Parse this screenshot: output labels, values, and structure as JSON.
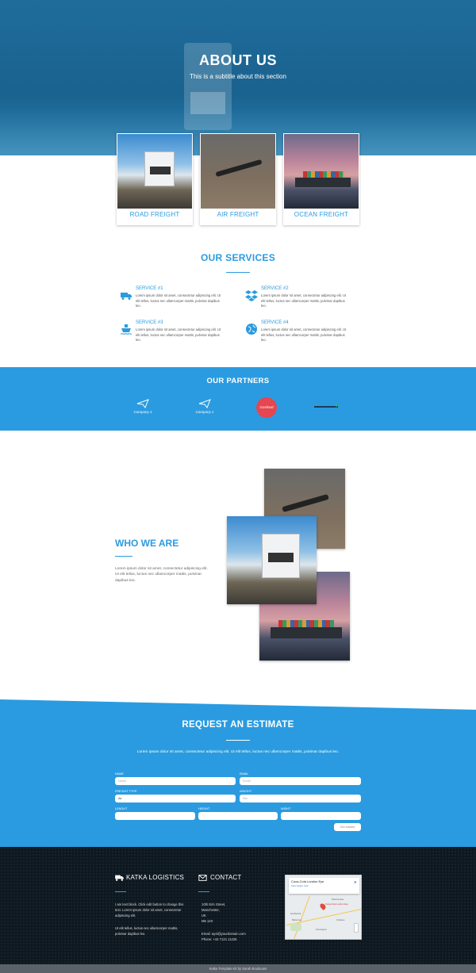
{
  "hero": {
    "title": "ABOUT US",
    "subtitle": "This is a subtitle about this section"
  },
  "freight": [
    {
      "label": "ROAD FREIGHT"
    },
    {
      "label": "AIR FREIGHT"
    },
    {
      "label": "OCEAN FREIGHT"
    }
  ],
  "services": {
    "title": "OUR SERVICES",
    "items": [
      {
        "title": "SERVICE #1",
        "icon": "truck-icon",
        "text": "Lorem ipsum dolor sit amet, consectetur adipiscing elit. Ut elit tellus, luctus nec ullamcorper mattis, pulvinar dapibus leo."
      },
      {
        "title": "SERVICE #2",
        "icon": "dropbox-icon",
        "text": "Lorem ipsum dolor sit amet, consectetur adipiscing elit. Ut elit tellus, luctus nec ullamcorper mattis, pulvinar dapibus leo."
      },
      {
        "title": "SERVICE #3",
        "icon": "ship-icon",
        "text": "Lorem ipsum dolor sit amet, consectetur adipiscing elit. Ut elit tellus, luctus nec ullamcorper mattis, pulvinar dapibus leo."
      },
      {
        "title": "SERVICE #4",
        "icon": "globe-icon",
        "text": "Lorem ipsum dolor sit amet, consectetur adipiscing elit. Ut elit tellus, luctus nec ullamcorper mattis, pulvinar dapibus leo."
      }
    ]
  },
  "partners": {
    "title": "OUR PARTNERS",
    "logos": [
      {
        "name": "Company 1"
      },
      {
        "name": "Company 1"
      },
      {
        "name": "Gasfood"
      },
      {
        "name": ""
      }
    ]
  },
  "who": {
    "title": "WHO WE ARE",
    "text": "Lorem ipsum dolor sit amet, consectetur adipiscing elit. Ut elit tellus, luctus nec ullamcorper mattis, pulvinar dapibus leo."
  },
  "estimate": {
    "title": "REQUEST AN ESTIMATE",
    "desc": "Lorem ipsum dolor sit amet, consectetur adipiscing elit. Ut elit tellus, luctus nec ullamcorper mattis, pulvinar dapibus leo.",
    "fields": {
      "name": {
        "label": "NAME",
        "placeholder": "Name"
      },
      "email": {
        "label": "EMAIL",
        "placeholder": "Email"
      },
      "freight": {
        "label": "FREIGHT TYPE",
        "value": "Air"
      },
      "weight": {
        "label": "WEIGHT",
        "placeholder": "Kilo"
      },
      "length": {
        "label": "LENGHT"
      },
      "height": {
        "label": "HEIGHT"
      },
      "width": {
        "label": "WIDHT"
      }
    },
    "button": "Get started"
  },
  "footer": {
    "brand": "KATKA LOGISTICS",
    "about1": "I am text block. Click edit button to change this text. Lorem ipsum dolor sit amet, consectetur adipiscing elit.",
    "about2": "Ut elit tellus, luctus nec ullamcorper mattis, pulvinar dapibus leo.",
    "contact_title": "CONTACT",
    "address": [
      "10th Erin Street,",
      "Manchester,",
      "UK",
      "M5 12X"
    ],
    "email": "Email: ayol@yourdomain.com",
    "phone": "Phone: +44 7121 11225",
    "map": {
      "title": "Coca-Cola London Eye",
      "link": "View larger map",
      "pin_label": "Coca-Cola London Eye",
      "places": [
        "Southwark",
        "Westminster",
        "Battersea",
        "Chelsea",
        "Kensington"
      ]
    },
    "credit": "Katka Template Kit by Sarah Boulouam"
  },
  "colors": {
    "accent": "#2a9be0",
    "hero": "#1f6c9b",
    "footer": "#0d1820",
    "partner_logo": "#e5464f"
  }
}
